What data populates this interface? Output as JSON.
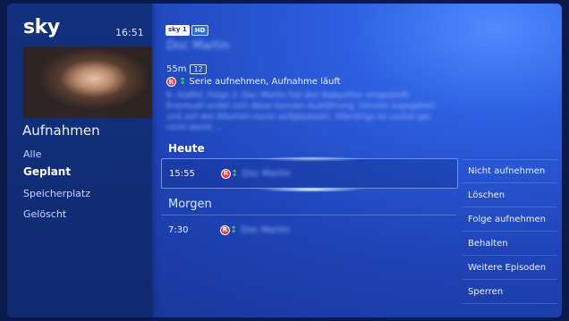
{
  "header": {
    "logo": "sky",
    "time": "16:51",
    "channel_badges": [
      "sky 1",
      "HD"
    ],
    "program_title": "Doc Martin"
  },
  "sidebar": {
    "title": "Aufnahmen",
    "items": [
      {
        "label": "Alle"
      },
      {
        "label": "Geplant"
      },
      {
        "label": "Speicherplatz"
      },
      {
        "label": "Gelöscht"
      }
    ]
  },
  "program": {
    "duration": "55m",
    "age_rating": "12",
    "status_text": "Serie aufnehmen, Aufnahme läuft",
    "rec_glyph": "R",
    "arrows_glyph": "↕",
    "description": "6. Staffel, Folge 2: Doc Martin hat den Babysitter eingestellt. Eventuell endet sich diese kennen Ausführung, Unruhe zugegeben und auf den Bäumen zuvor aufgepassen. Allerdings ist Louise gar nicht damit ..."
  },
  "schedule": {
    "today_label": "Heute",
    "tomorrow_label": "Morgen",
    "today": [
      {
        "time": "15:55",
        "title": "Doc Martin"
      }
    ],
    "tomorrow": [
      {
        "time": "7:30",
        "title": "Doc Martin"
      }
    ]
  },
  "actions": [
    {
      "label": "Nicht aufnehmen"
    },
    {
      "label": "Löschen"
    },
    {
      "label": "Folge aufnehmen"
    },
    {
      "label": "Behalten"
    },
    {
      "label": "Weitere Episoden"
    },
    {
      "label": "Sperren"
    }
  ],
  "colors": {
    "background": "#1f44b8",
    "sidebar": "#12307e",
    "rec_red": "#e83a4a",
    "arrows_green": "#4fdc6a"
  },
  "icons": [
    "sky-logo",
    "record-icon",
    "series-arrows-icon"
  ]
}
